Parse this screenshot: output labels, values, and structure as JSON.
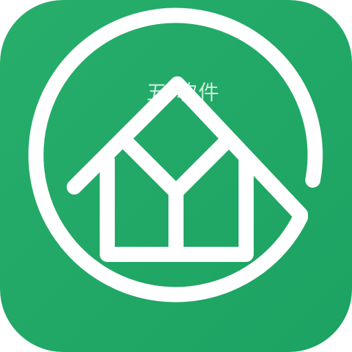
{
  "app_icon": {
    "icon_name": "house-logo-icon",
    "background_color": "#20AA68",
    "foreground_color": "#FFFFFF",
    "watermark_text": "五 软件"
  }
}
